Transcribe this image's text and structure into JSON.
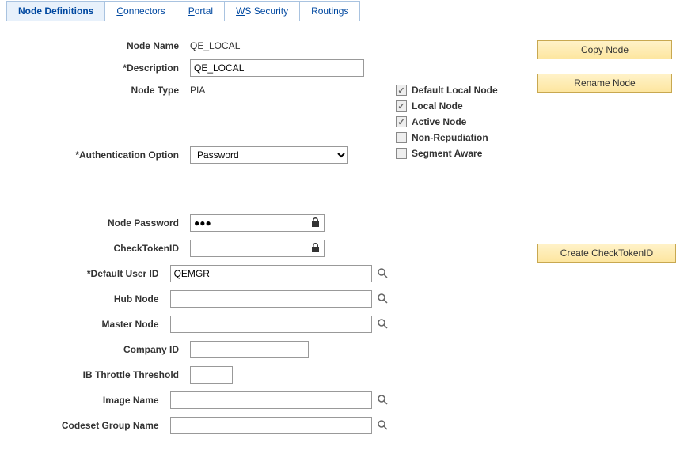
{
  "tabs": {
    "node_definitions": "Node Definitions",
    "connectors_u": "C",
    "connectors_rest": "onnectors",
    "portal_u": "P",
    "portal_rest": "ortal",
    "ws_u": "W",
    "ws_rest": "S Security",
    "routings": "Routings"
  },
  "labels": {
    "node_name": "Node Name",
    "description": "*Description",
    "node_type": "Node Type",
    "auth_option": "*Authentication Option",
    "node_password": "Node Password",
    "check_token_id": "CheckTokenID",
    "default_user_id": "*Default User ID",
    "hub_node": "Hub Node",
    "master_node": "Master Node",
    "company_id": "Company ID",
    "ib_throttle": "IB Throttle Threshold",
    "image_name": "Image Name",
    "codeset_group": "Codeset Group Name"
  },
  "values": {
    "node_name": "QE_LOCAL",
    "description": "QE_LOCAL",
    "node_type": "PIA",
    "auth_option": "Password",
    "node_password": "●●●",
    "check_token_id": "",
    "default_user_id": "QEMGR",
    "hub_node": "",
    "master_node": "",
    "company_id": "",
    "ib_throttle": "",
    "image_name": "",
    "codeset_group": ""
  },
  "checks": {
    "default_local_node": "Default Local Node",
    "local_node": "Local Node",
    "active_node": "Active Node",
    "non_repudiation": "Non-Repudiation",
    "segment_aware": "Segment Aware"
  },
  "buttons": {
    "copy_node": "Copy Node",
    "rename_node": "Rename Node",
    "create_check_token": "Create CheckTokenID"
  }
}
